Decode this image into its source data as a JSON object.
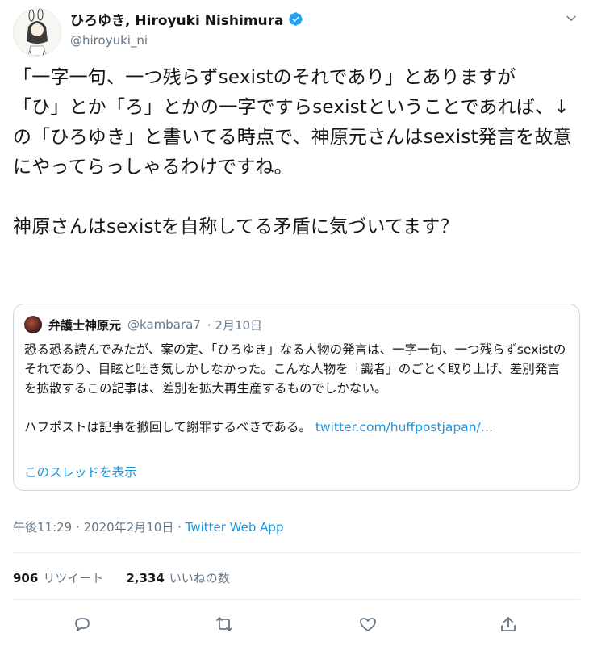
{
  "author": {
    "display_name": "ひろゆき, Hiroyuki Nishimura",
    "handle": "@hiroyuki_ni",
    "verified": true
  },
  "tweet": {
    "text": "「一字一句、一つ残らずsexistのそれであり」とありますが\n「ひ」とか「ろ」とかの一字ですらsexistということであれば、↓の「ひろゆき」と書いてる時点で、神原元さんはsexist発言を故意にやってらっしゃるわけですね。\n\n神原さんはsexistを自称してる矛盾に気づいてます？"
  },
  "quote": {
    "display_name": "弁護士神原元",
    "handle": "@kambara7",
    "date": "· 2月10日",
    "body": "恐る恐る読んでみたが、案の定、「ひろゆき」なる人物の発言は、一字一句、一つ残らずsexistのそれであり、目眩と吐き気しかしなかった。こんな人物を「識者」のごとく取り上げ、差別発言を拡散するこの記事は、差別を拡大再生産するものでしかない。\n\nハフポストは記事を撤回して謝罪するべきである。 ",
    "link": "twitter.com/huffpostjapan/…",
    "thread_label": "このスレッドを表示"
  },
  "meta": {
    "timestamp": "午後11:29 · 2020年2月10日 · ",
    "source": "Twitter Web App"
  },
  "stats": {
    "retweets_count": "906",
    "retweets_label": "リツイート",
    "likes_count": "2,334",
    "likes_label": "いいねの数"
  },
  "colors": {
    "link": "#1b95e0",
    "muted": "#657786",
    "border": "#ccd6dd",
    "verified": "#1da1f2"
  },
  "icons": [
    "verified-badge-icon",
    "chevron-down-icon",
    "reply-icon",
    "retweet-icon",
    "like-icon",
    "share-icon"
  ]
}
